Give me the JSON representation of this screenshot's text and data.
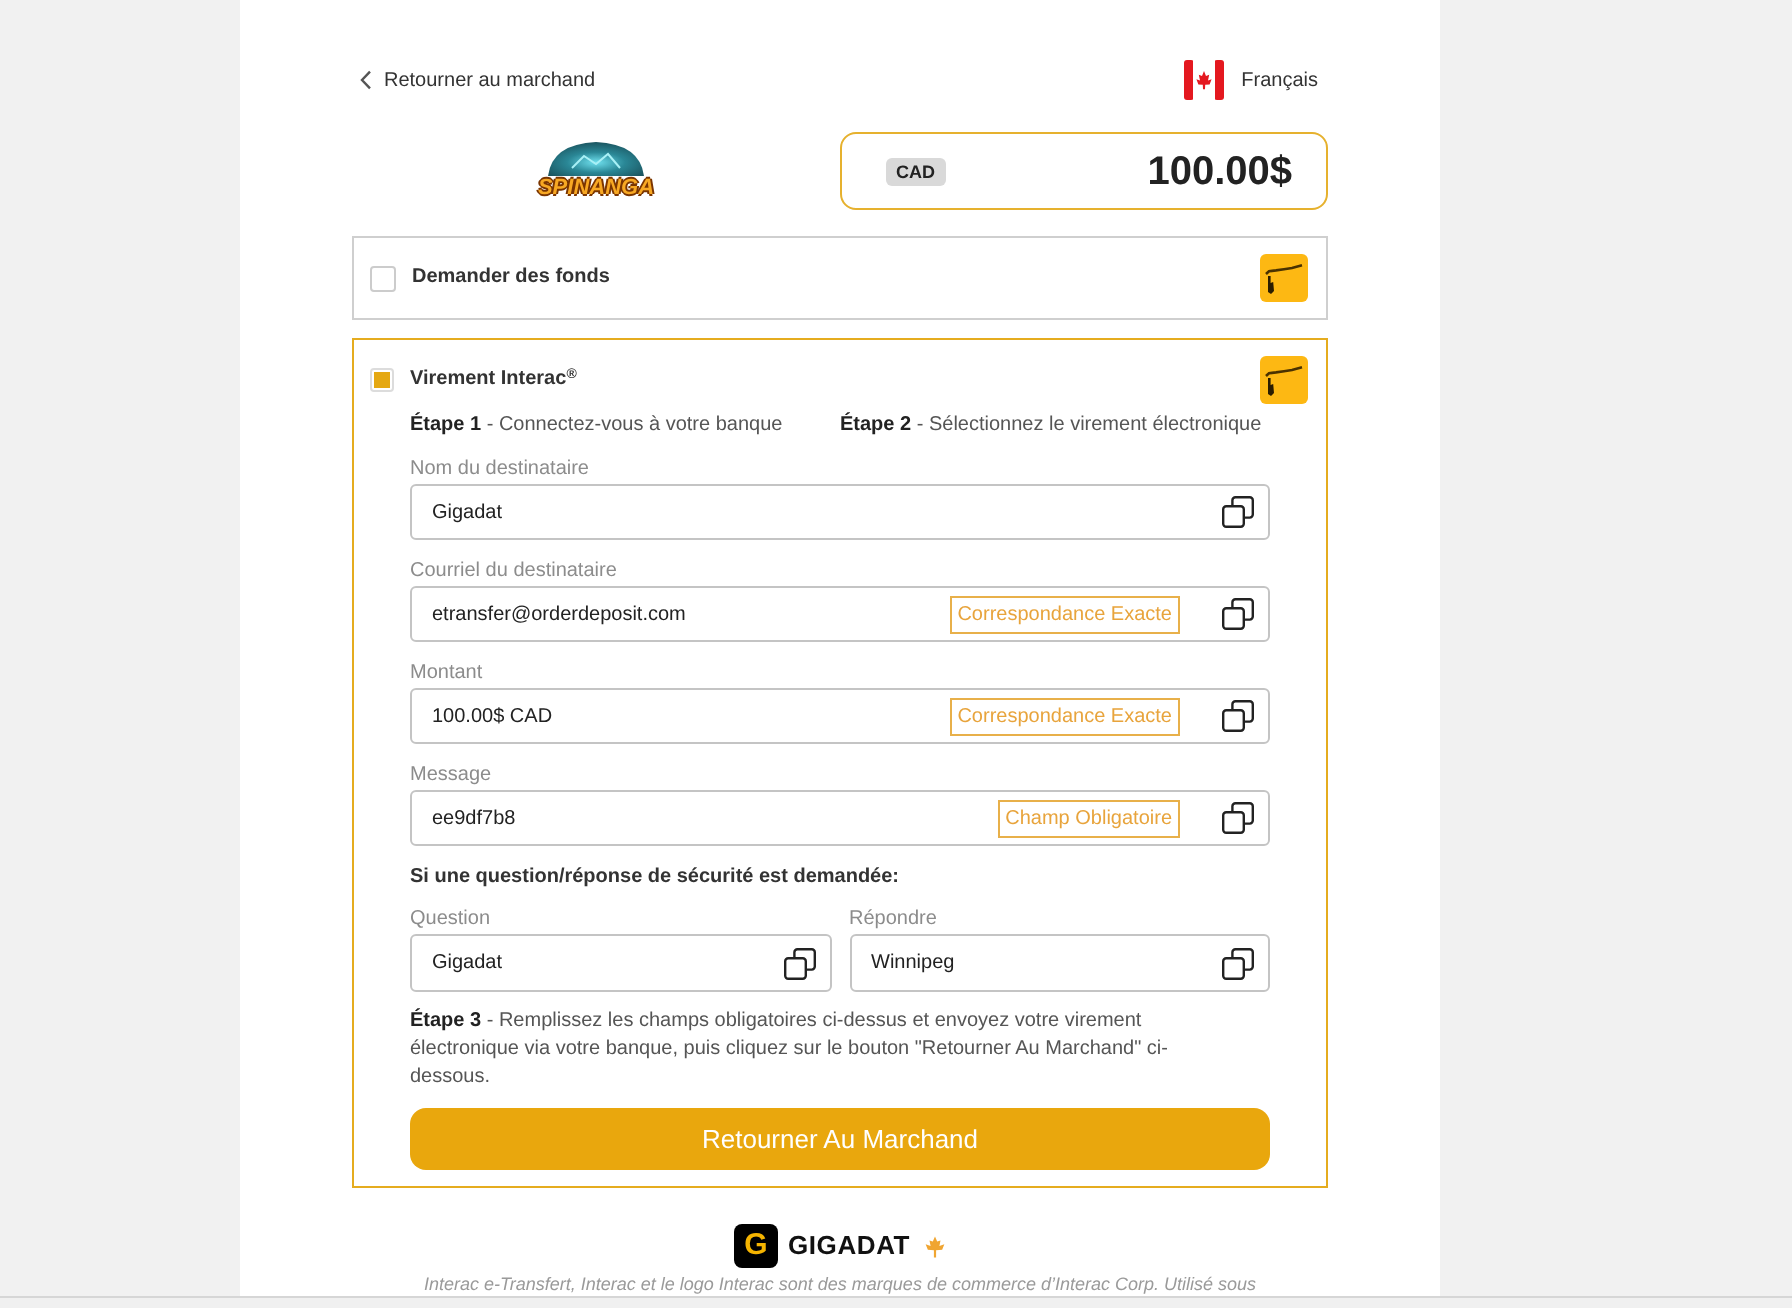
{
  "header": {
    "back_link": "Retourner au marchand",
    "language": "Français"
  },
  "merchant": {
    "logo_text": "SPINANGA",
    "currency": "CAD",
    "amount": "100.00$"
  },
  "payment_options": [
    {
      "label": "Demander des fonds",
      "selected": false
    },
    {
      "label": "Virement Interac$^{®}$",
      "selected": true,
      "details": {
        "steps": [
          "**Étape 1** - Connectez-vous à votre banque",
          "**Étape 2** - Sélectionnez le virement électronique"
        ],
        "fields": [
          {
            "label": "Nom du destinataire",
            "value": "Gigadat"
          },
          {
            "label": "Courriel du destinataire",
            "value": "etransfer@orderdeposit.com",
            "note": "Correspondance Exacte"
          },
          {
            "label": "Montant",
            "value": "100.00$ CAD",
            "note": "Correspondance Exacte"
          },
          {
            "label": "Message",
            "value": "ee9df7b8",
            "note": "Champ Obligatoire"
          }
        ],
        "security": {
          "heading": "Si une question/réponse de sécurité est demandée:",
          "fields": [
            {
              "label": "Question",
              "value": "Gigadat"
            },
            {
              "label": "Répondre",
              "value": "Winnipeg"
            }
          ]
        },
        "instructions": "**Étape 3** - Remplissez les champs obligatoires ci-dessus et envoyez votre virement électronique via votre banque, puis cliquez sur le bouton \"Retourner Au Marchand\" ci-dessous.",
        "button": "Retourner Au Marchand"
      }
    }
  ],
  "footer": {
    "logo_letter": "G",
    "brand": "GIGADAT",
    "legal": "Interac e-Transfert, Interac et le logo Interac sont des marques de commerce d’Interac Corp. Utilisé sous"
  }
}
